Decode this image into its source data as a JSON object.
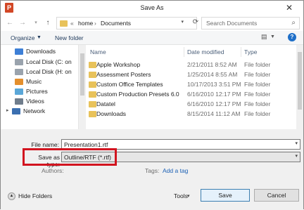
{
  "window": {
    "title": "Save As",
    "app_icon_letter": "P"
  },
  "navigation": {
    "path": [
      "home",
      "Documents"
    ],
    "path_prefix": "«",
    "search_placeholder": "Search Documents"
  },
  "toolbar": {
    "organize_label": "Organize",
    "new_folder_label": "New folder"
  },
  "sidebar": {
    "items": [
      {
        "label": "Downloads",
        "icon": "downloads-icon"
      },
      {
        "label": "Local Disk (C: on",
        "icon": "drive-icon"
      },
      {
        "label": "Local Disk (H: on",
        "icon": "drive-icon"
      },
      {
        "label": "Music",
        "icon": "music-icon"
      },
      {
        "label": "Pictures",
        "icon": "pictures-icon"
      },
      {
        "label": "Videos",
        "icon": "videos-icon"
      },
      {
        "label": "Network",
        "icon": "network-icon"
      }
    ]
  },
  "file_list": {
    "columns": {
      "name": "Name",
      "date": "Date modified",
      "type": "Type"
    },
    "rows": [
      {
        "name": "Apple Workshop",
        "date": "2/21/2011 8:52 AM",
        "type": "File folder"
      },
      {
        "name": "Assessment Posters",
        "date": "1/25/2014 8:55 AM",
        "type": "File folder"
      },
      {
        "name": "Custom Office Templates",
        "date": "10/17/2013 3:51 PM",
        "type": "File folder"
      },
      {
        "name": "Custom Production Presets 6.0",
        "date": "6/16/2010 12:17 PM",
        "type": "File folder"
      },
      {
        "name": "Datatel",
        "date": "6/16/2010 12:17 PM",
        "type": "File folder"
      },
      {
        "name": "Downloads",
        "date": "8/15/2014 11:12 AM",
        "type": "File folder"
      }
    ]
  },
  "form": {
    "file_name_label": "File name:",
    "file_name_value": "Presentation1.rtf",
    "save_type_label": "Save as type:",
    "save_type_value": "Outline/RTF (*.rtf)",
    "authors_label": "Authors:",
    "tags_label": "Tags:",
    "add_tag_label": "Add a tag"
  },
  "footer": {
    "hide_folders_label": "Hide Folders",
    "tools_label": "Tools",
    "save_label": "Save",
    "cancel_label": "Cancel"
  },
  "colors": {
    "highlight": "#d2141f",
    "link": "#1a5fb4",
    "folder": "#e8c25a"
  }
}
